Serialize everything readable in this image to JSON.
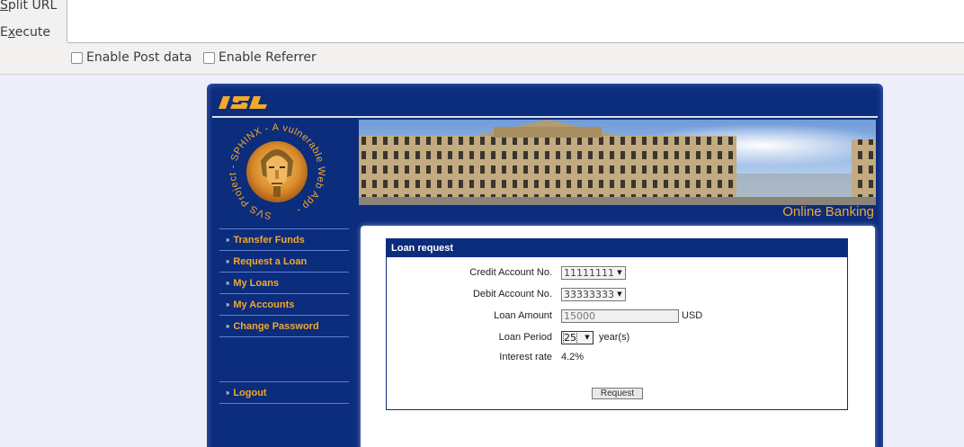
{
  "toolbar": {
    "split_url_prefix": "S",
    "split_url_rest": "plit URL",
    "execute_prefix": "E",
    "execute_mid": "x",
    "execute_rest": "ecute",
    "enable_post": "Enable Post data",
    "enable_referrer": "Enable Referrer"
  },
  "site": {
    "logo_text": "ISL",
    "sphinx_text": "SVS Project - SPHINX - A vulnerable Web App -",
    "banner_title": "Online Banking",
    "nav": [
      {
        "label": "Transfer Funds"
      },
      {
        "label": "Request a Loan"
      },
      {
        "label": "My Loans"
      },
      {
        "label": "My Accounts"
      },
      {
        "label": "Change Password"
      }
    ],
    "logout": "Logout",
    "nav_arrow": "››"
  },
  "loan": {
    "header": "Loan request",
    "credit_label": "Credit Account No.",
    "credit_value": "11111111",
    "debit_label": "Debit Account No.",
    "debit_value": "33333333",
    "amount_label": "Loan Amount",
    "amount_value": "15000",
    "amount_unit": "USD",
    "period_label": "Loan Period",
    "period_value": "25",
    "period_unit": "year(s)",
    "rate_label": "Interest rate",
    "rate_value": "4.2%",
    "request_button": "Request"
  },
  "colors": {
    "site_blue": "#0c2c7c",
    "accent_orange": "#f2a92d",
    "page_bg": "#eeeefb"
  }
}
